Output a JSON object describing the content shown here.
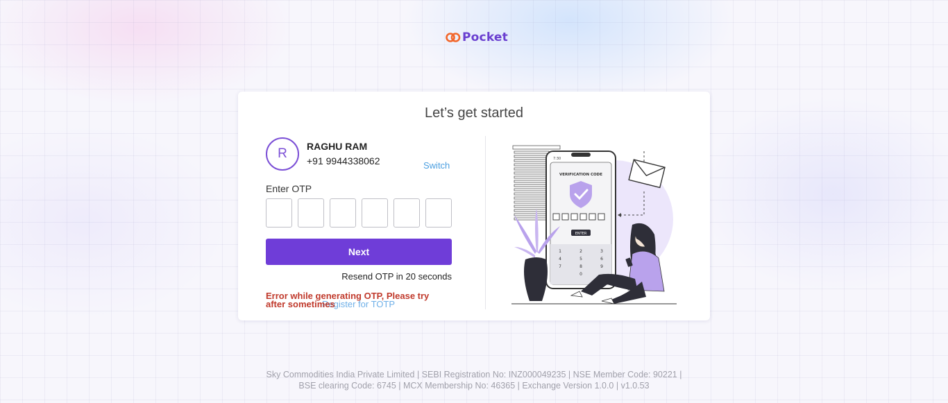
{
  "brand": {
    "name": "Pocket"
  },
  "card": {
    "title": "Let’s get started",
    "user": {
      "initial": "R",
      "name": "RAGHU RAM",
      "phone": "+91 9944338062"
    },
    "switch_label": "Switch",
    "otp_label": "Enter OTP",
    "otp_digits": [
      "",
      "",
      "",
      "",
      "",
      ""
    ],
    "next_label": "Next",
    "resend_text": "Resend OTP in 20 seconds",
    "register_label": "Register for TOTP",
    "error_text": "Error while generating OTP, Please try after sometimes",
    "illustration": {
      "screen_title": "VERIFICATION CODE",
      "enter_label": "ENTER",
      "status_time": "7:30",
      "keypad": [
        "1",
        "2",
        "3",
        "4",
        "5",
        "6",
        "7",
        "8",
        "9",
        "0"
      ]
    }
  },
  "footer": {
    "line1": "Sky Commodities India Private Limited | SEBI Registration No: INZ000049235 | NSE Member Code: 90221 |",
    "line2": "BSE clearing Code: 6745 | MCX Membership No: 46365 | Exchange Version 1.0.0 | v1.0.53"
  },
  "colors": {
    "accent": "#6f3dd8",
    "link": "#4a9ee0",
    "error": "#c0392b",
    "logo_orange": "#f2662a"
  }
}
